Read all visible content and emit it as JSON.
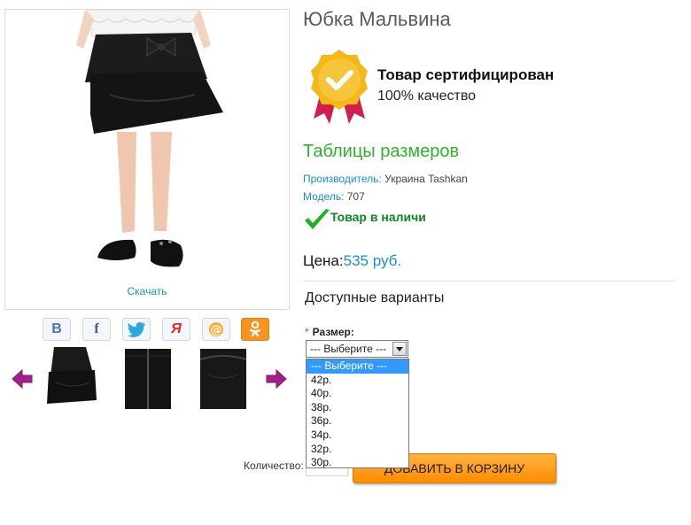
{
  "product": {
    "title": "Юбка Мальвина",
    "download_label": "Скачать"
  },
  "certificate": {
    "title": "Товар сертифицирован",
    "subtitle": "100% качество"
  },
  "sizes_table_link": "Таблицы размеров",
  "meta": {
    "manufacturer_key": "Производитель:",
    "manufacturer_value": "Украина Tashkan",
    "model_key": "Модель:",
    "model_value": "707"
  },
  "stock_status": "Товар в наличи",
  "price": {
    "label": "Цена:",
    "value": "535 руб."
  },
  "variants_heading": "Доступные варианты",
  "size_field": {
    "required_mark": "*",
    "label": "Размер:",
    "selected": "--- Выберите ---",
    "options": [
      "--- Выберите ---",
      "42р.",
      "40р.",
      "38р.",
      "36р.",
      "34р.",
      "32р.",
      "30р."
    ]
  },
  "quantity_label": "Количество:",
  "add_to_cart_label": "ДОБАВИТЬ В КОРЗИНУ",
  "share_icons": [
    "vk-icon",
    "facebook-icon",
    "twitter-icon",
    "yandex-icon",
    "mail-icon",
    "odnoklassniki-icon"
  ],
  "colors": {
    "accent_blue": "#1a8fc9",
    "green": "#2fb02f",
    "cart_orange": "#ff9a1a",
    "select_highlight": "#3399ff"
  }
}
